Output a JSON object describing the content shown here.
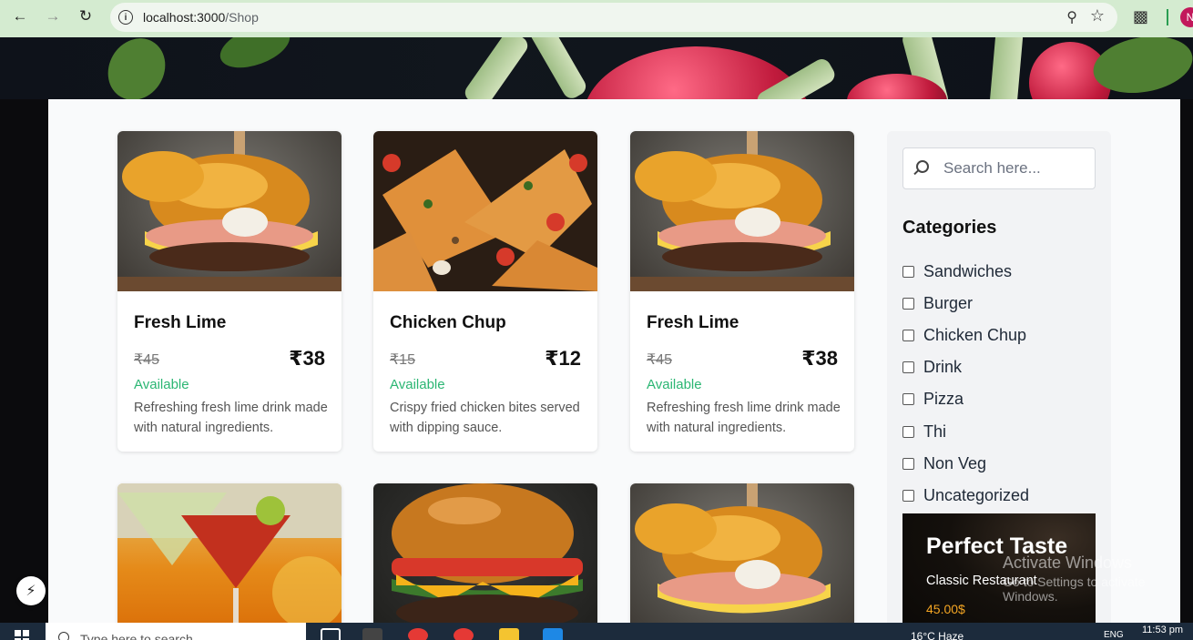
{
  "browser": {
    "url_host": "localhost:3000",
    "url_path": "/Shop",
    "profile_initial": "N"
  },
  "products": [
    {
      "title": "Fresh Lime",
      "old_price": "₹45",
      "price": "₹38",
      "status": "Available",
      "description": "Refreshing fresh lime drink made with natural ingredients.",
      "image": "burger-photo"
    },
    {
      "title": "Chicken Chup",
      "old_price": "₹15",
      "price": "₹12",
      "status": "Available",
      "description": "Crispy fried chicken bites served with dipping sauce.",
      "image": "pizza-photo"
    },
    {
      "title": "Fresh Lime",
      "old_price": "₹45",
      "price": "₹38",
      "status": "Available",
      "description": "Refreshing fresh lime drink made with natural ingredients.",
      "image": "burger-photo"
    },
    {
      "image": "cocktail-photo"
    },
    {
      "image": "burger-photo"
    },
    {
      "image": "burger-photo"
    }
  ],
  "sidebar": {
    "search_placeholder": "Search here...",
    "categories_title": "Categories",
    "categories": [
      "Sandwiches",
      "Burger",
      "Chicken Chup",
      "Drink",
      "Pizza",
      "Thi",
      "Non Veg",
      "Uncategorized"
    ],
    "promo": {
      "title": "Perfect Taste",
      "subtitle": "Classic Restaurant",
      "price": "45.00$"
    }
  },
  "watermark": {
    "line1": "Activate Windows",
    "line2": "Go to Settings to activate Windows."
  },
  "taskbar": {
    "search_text": "Type here to search",
    "weather": "16°C  Haze",
    "lang": "ENG",
    "time": "11:53 pm"
  },
  "colors": {
    "available": "#2bb673",
    "promo_price": "#f5a623",
    "chrome_bg": "#d4ebd0"
  }
}
